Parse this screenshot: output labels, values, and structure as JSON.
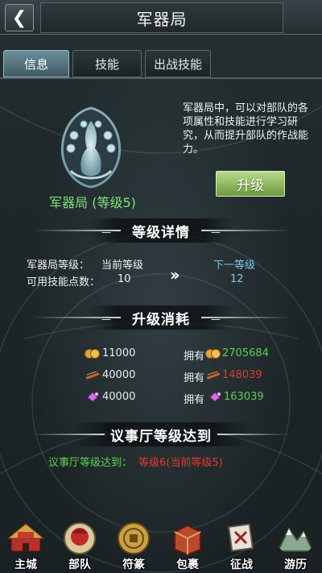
{
  "header": {
    "title": "军器局",
    "back_icon": "back-arrow-icon"
  },
  "tabs": [
    {
      "label": "信息",
      "active": true
    },
    {
      "label": "技能",
      "active": false
    },
    {
      "label": "出战技能",
      "active": false
    }
  ],
  "building": {
    "name_level": "军器局 (等级5)",
    "description": "军器局中，可以对部队的各项属性和技能进行学习研究，从而提升部队的作战能力。",
    "upgrade_label": "升级"
  },
  "level_details": {
    "title": "等级详情",
    "row1_label": "军器局等级：",
    "current_label": "当前等级",
    "next_label": "下一等级",
    "row2_label": "可用技能点数：",
    "current_points": "10",
    "next_points": "12"
  },
  "upgrade_cost": {
    "title": "升级消耗",
    "owned_label": "拥有",
    "items": [
      {
        "icon": "coin-icon",
        "cost": "11000",
        "owned": "2705684"
      },
      {
        "icon": "wood-plank-icon",
        "cost": "40000",
        "owned": "148039"
      },
      {
        "icon": "crystal-icon",
        "cost": "40000",
        "owned": "163039"
      }
    ]
  },
  "requirement": {
    "title": "议事厅等级达到",
    "label": "议事厅等级达到：",
    "value": "等级6(当前等级5)"
  },
  "nav": [
    {
      "label": "主城",
      "icon": "main-city-icon"
    },
    {
      "label": "部队",
      "icon": "troops-icon"
    },
    {
      "label": "符篆",
      "icon": "talisman-icon"
    },
    {
      "label": "包裹",
      "icon": "bag-icon"
    },
    {
      "label": "征战",
      "icon": "battle-icon"
    },
    {
      "label": "游历",
      "icon": "travel-icon"
    }
  ],
  "colors": {
    "green": "#59d24f",
    "red": "#e03a2e",
    "cyan": "#7cc6e8",
    "button": "#8fbf5e"
  }
}
